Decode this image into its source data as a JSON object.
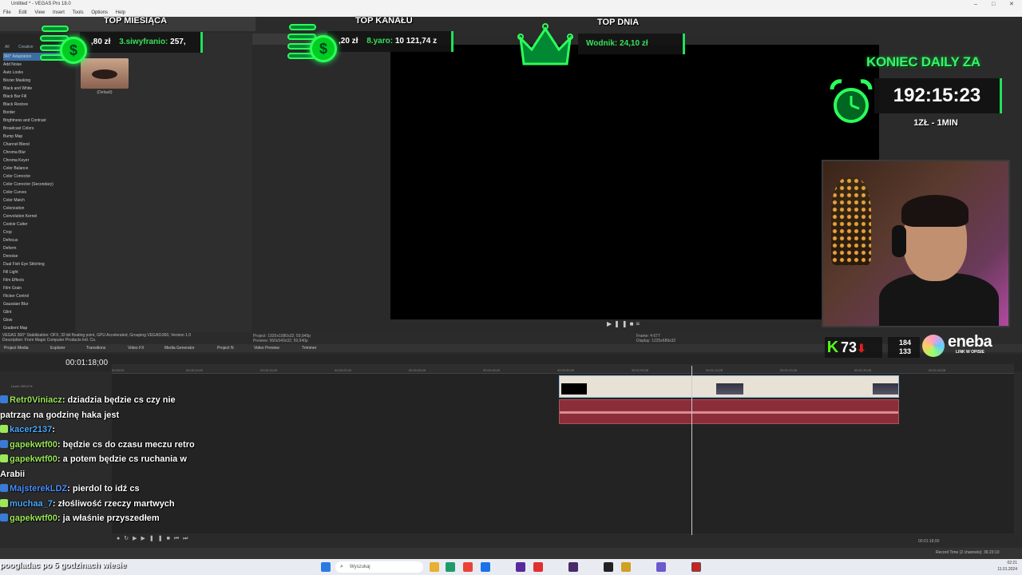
{
  "window": {
    "title": "Untitled * - VEGAS Pro 18.0"
  },
  "menu": [
    "File",
    "Edit",
    "View",
    "Insert",
    "Tools",
    "Options",
    "Help"
  ],
  "fx": {
    "tabs": [
      "All",
      "Creative"
    ],
    "items": [
      "360° Adaptation",
      "Add Noise",
      "Auto Looks",
      "Bézier Masking",
      "Black and White",
      "Black Bar Fill",
      "Black Restore",
      "Border",
      "Brightness and Contrast",
      "Broadcast Colors",
      "Bump Map",
      "Channel Blend",
      "Chroma Blur",
      "Chroma Keyer",
      "Color Balance",
      "Color Corrector",
      "Color Corrector (Secondary)",
      "Color Curves",
      "Color Match",
      "Colorization",
      "Convolution Kernel",
      "Cookie Cutter",
      "Crop",
      "Defocus",
      "Deform",
      "Denoise",
      "Dual Fish Eye Stitching",
      "Fill Light",
      "Film Effects",
      "Film Grain",
      "Flicker Control",
      "Gaussian Blur",
      "Glint",
      "Glow",
      "Gradient Map"
    ],
    "preset_label": "(Default)",
    "description": "VEGAS 360° Stabilization: OFX, 32-bit floating point, GPU Accelerated, Grouping VEGAS\\360, Version 1.0",
    "description2": "Description: From Magix Computer Products Intl. Co."
  },
  "dock_tabs": [
    "Project Media",
    "Explorer",
    "Transitions",
    "Video FX",
    "Media Generator",
    "Project N",
    "Video Preview",
    "Trimmer"
  ],
  "preview": {
    "project": "Project:   1920x1080x32; 59,940p",
    "preview": "Preview:   960x540x32; 59,940p",
    "frame": "Frame:     4 677",
    "display": "Display:   1225x689x32"
  },
  "timeline": {
    "timecode": "00:01:18;00",
    "ticks": [
      "00:00:00",
      "00:00:10;00",
      "00:00:19;29",
      "00:00:29;29",
      "00:00:39;29",
      "00:00:49;29",
      "00:00:59;28",
      "00:01:09;28",
      "00:01:19;28",
      "00:01:29;28",
      "00:01:39;28",
      "00:01:49;28"
    ],
    "level": "Level: 100,0 %",
    "end_time": "00:01:18;00",
    "record_time": "Record Time (2 channels): 36:23:10"
  },
  "overlay": {
    "top_month": {
      "title": "TOP MIESIĄCA",
      "left_amount": ",80 zł",
      "rank_name": "3.siwyfraniо:",
      "value": "257,"
    },
    "top_channel": {
      "title": "TOP KANAŁU",
      "left_amount": ",20 zł",
      "rank_name": "8.yaro:",
      "value": "10 121,74 z"
    },
    "top_day": {
      "title": "TOP DNIA",
      "text": "Wodnik: 24,10 zł"
    },
    "koniec": "KONIEC DAILY ZA",
    "timer": "192:15:23",
    "rate": "1ZŁ - 1MIN",
    "kick_count": "73",
    "viewers_a": "184",
    "viewers_b": "133",
    "eneba": "eneba",
    "eneba_sub": "LINK W OPISIE"
  },
  "chat": [
    {
      "user": "Retr0Viniacz",
      "msg": ": dziadzia będzie cs czy nie patrząc na godzinę haka jest",
      "color": "#9de85a"
    },
    {
      "user": "kacer2137",
      "msg": ": ",
      "color": "#4aa8ff"
    },
    {
      "user": "gapekwtf00",
      "msg": ": będzie cs do czasu meczu retro",
      "color": "#9de85a"
    },
    {
      "user": "gapekwtf00",
      "msg": ": a potem będzie cs ruchania w Arabii",
      "color": "#9de85a"
    },
    {
      "user": "MajsterekLDZ",
      "msg": ": pierdol to idź cs",
      "color": "#4a90ff"
    },
    {
      "user": "muchaa_7",
      "msg": ": złośliwość rzeczy martwych",
      "color": "#4aa8ff"
    },
    {
      "user": "gapekwtf00",
      "msg": ": ja właśnie przyszedłem",
      "color": "#9de85a"
    }
  ],
  "bottom_overlay": "poogladac po 5 godzinach wiesie",
  "taskbar": {
    "search_placeholder": "Wyszukaj",
    "time": "02:21",
    "date": "11.01.2024"
  }
}
